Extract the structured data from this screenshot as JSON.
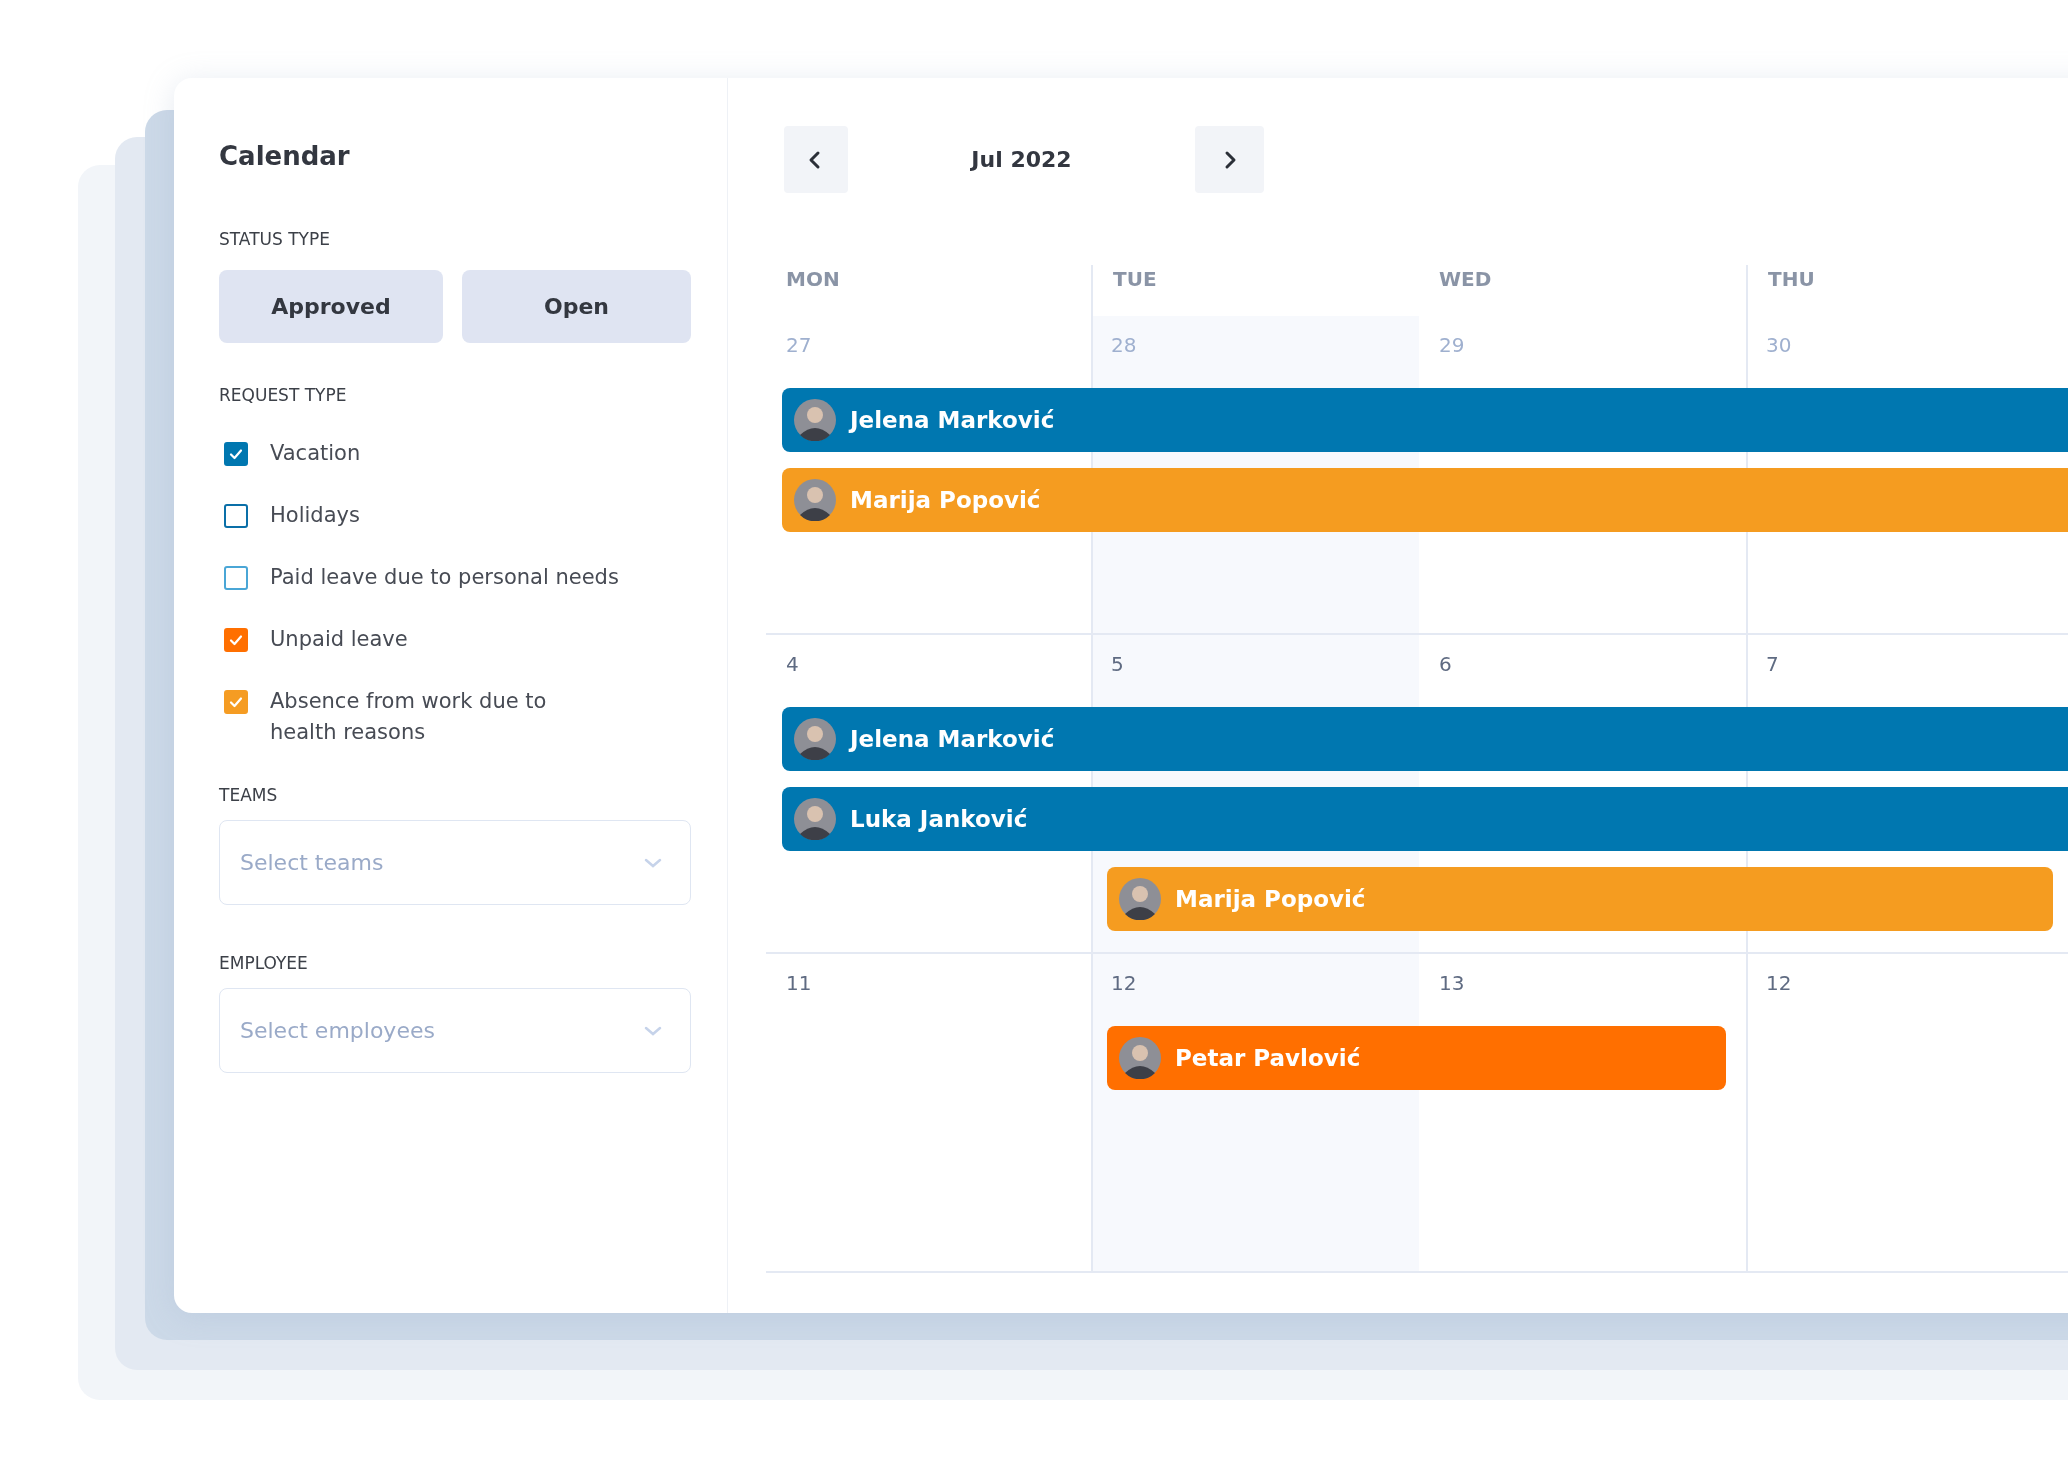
{
  "sidebar": {
    "title": "Calendar",
    "status_type": {
      "label": "STATUS TYPE",
      "buttons": [
        {
          "label": "Approved"
        },
        {
          "label": "Open"
        }
      ]
    },
    "request_type": {
      "label": "REQUEST TYPE",
      "options": [
        {
          "label": "Vacation",
          "checked": true,
          "color": "#0077b0"
        },
        {
          "label": "Holidays",
          "checked": false,
          "color": "#0a6fa8"
        },
        {
          "label": "Paid leave due to personal needs",
          "checked": false,
          "color": "#4aa6d6"
        },
        {
          "label": "Unpaid leave",
          "checked": true,
          "color": "#ff6f00"
        },
        {
          "label": "Absence from work due to\nhealth reasons",
          "checked": true,
          "color": "#f59c23"
        }
      ]
    },
    "teams": {
      "label": "TEAMS",
      "placeholder": "Select teams"
    },
    "employee": {
      "label": "EMPLOYEE",
      "placeholder": "Select employees"
    }
  },
  "calendar": {
    "month": "Jul 2022",
    "days": [
      {
        "label": "MON",
        "highlighted": false
      },
      {
        "label": "TUE",
        "highlighted": true
      },
      {
        "label": "WED",
        "highlighted": false
      },
      {
        "label": "THU",
        "highlighted": false
      }
    ],
    "weeks": [
      {
        "dates": [
          {
            "text": "27",
            "muted": true
          },
          {
            "text": "28",
            "muted": true
          },
          {
            "text": "29",
            "muted": true
          },
          {
            "text": "30",
            "muted": true
          }
        ],
        "events": [
          {
            "name": "Jelena Marković",
            "color": "#0077b0"
          },
          {
            "name": "Marija Popović",
            "color": "#f59c20"
          }
        ]
      },
      {
        "dates": [
          {
            "text": "4",
            "muted": false
          },
          {
            "text": "5",
            "muted": false
          },
          {
            "text": "6",
            "muted": false
          },
          {
            "text": "7",
            "muted": false
          }
        ],
        "events": [
          {
            "name": "Jelena Marković",
            "color": "#0077b0"
          },
          {
            "name": "Luka Janković",
            "color": "#0077b0"
          },
          {
            "name": "Marija Popović",
            "color": "#f59c20"
          }
        ]
      },
      {
        "dates": [
          {
            "text": "11",
            "muted": false
          },
          {
            "text": "12",
            "muted": false
          },
          {
            "text": "13",
            "muted": false
          },
          {
            "text": "12",
            "muted": false
          }
        ],
        "events": [
          {
            "name": "Petar Pavlović",
            "color": "#ff6f00"
          }
        ]
      }
    ]
  }
}
